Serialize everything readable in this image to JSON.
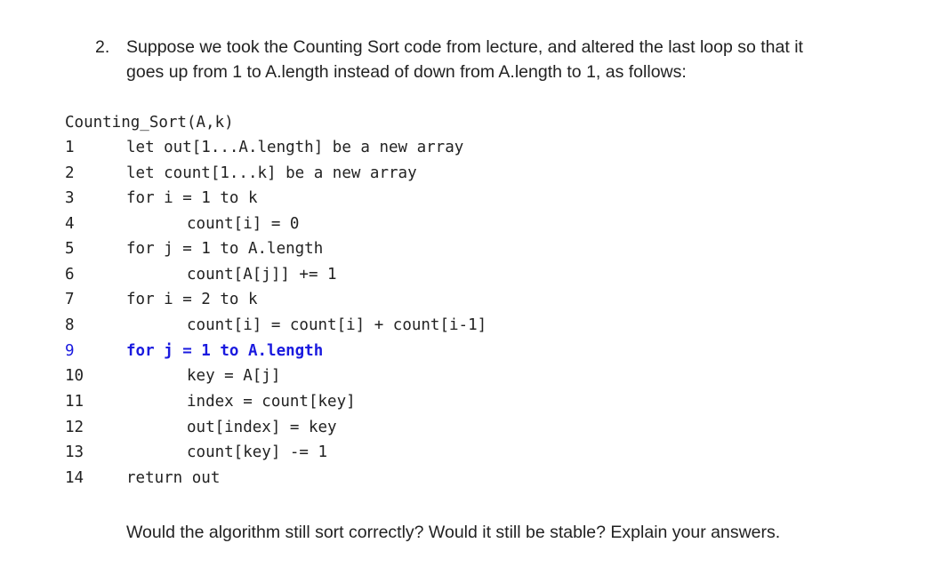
{
  "question": {
    "number": "2.",
    "line1": "Suppose we took the Counting Sort code from lecture, and altered the last loop so that it",
    "line2": "goes up from 1 to A.length instead of down from A.length to 1, as follows:"
  },
  "code": {
    "title": "Counting_Sort(A,k)",
    "highlight_color": "#1a1adf",
    "lines": [
      {
        "num": "1",
        "text": "let out[1...A.length] be a new array"
      },
      {
        "num": "2",
        "text": "let count[1...k] be a new array"
      },
      {
        "num": "3",
        "text": "for i = 1 to k"
      },
      {
        "num": "4",
        "text": "count[i] = 0"
      },
      {
        "num": "5",
        "text": "for j = 1 to A.length"
      },
      {
        "num": "6",
        "text": "count[A[j]] += 1"
      },
      {
        "num": "7",
        "text": "for i = 2 to k"
      },
      {
        "num": "8",
        "text": "count[i] = count[i] + count[i-1]"
      },
      {
        "num": "9",
        "text": "for j = 1 to A.length"
      },
      {
        "num": "10",
        "text": "key = A[j]"
      },
      {
        "num": "11",
        "text": "index = count[key]"
      },
      {
        "num": "12",
        "text": "out[index] = key"
      },
      {
        "num": "13",
        "text": "count[key] -= 1"
      },
      {
        "num": "14",
        "text": "return out"
      }
    ]
  },
  "prompt": "Would the algorithm still sort correctly?  Would it still be stable?  Explain your answers."
}
